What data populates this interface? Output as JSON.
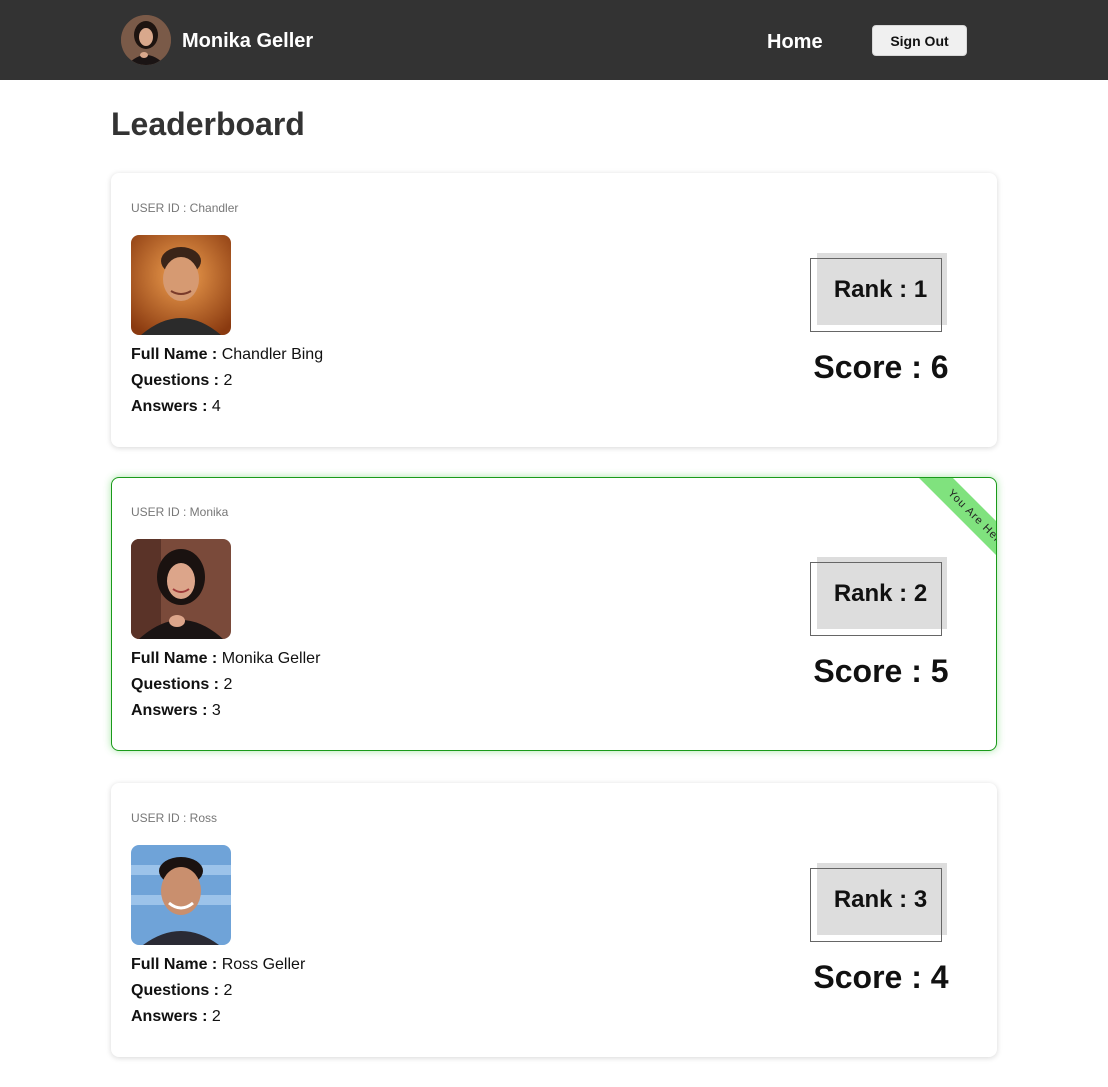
{
  "header": {
    "user_name": "Monika Geller",
    "home_label": "Home",
    "signout_label": "Sign Out",
    "avatar_icon": "user-avatar-icon"
  },
  "page": {
    "title": "Leaderboard"
  },
  "labels": {
    "full_name": "Full Name :",
    "questions": "Questions :",
    "answers": "Answers :"
  },
  "entries": [
    {
      "user_id": "USER ID : Chandler",
      "full_name": "Chandler Bing",
      "questions": "2",
      "answers": "4",
      "rank": "Rank : 1",
      "score": "Score : 6",
      "is_current_user": false
    },
    {
      "user_id": "USER ID : Monika",
      "full_name": "Monika Geller",
      "questions": "2",
      "answers": "3",
      "rank": "Rank : 2",
      "score": "Score : 5",
      "is_current_user": true,
      "ribbon": "You Are Here !!"
    },
    {
      "user_id": "USER ID : Ross",
      "full_name": "Ross Geller",
      "questions": "2",
      "answers": "2",
      "rank": "Rank : 3",
      "score": "Score : 4",
      "is_current_user": false
    }
  ],
  "colors": {
    "navbar": "#333333",
    "current_border": "#1a9a1a",
    "ribbon": "#80e27e",
    "rank_box": "#dddddd"
  }
}
